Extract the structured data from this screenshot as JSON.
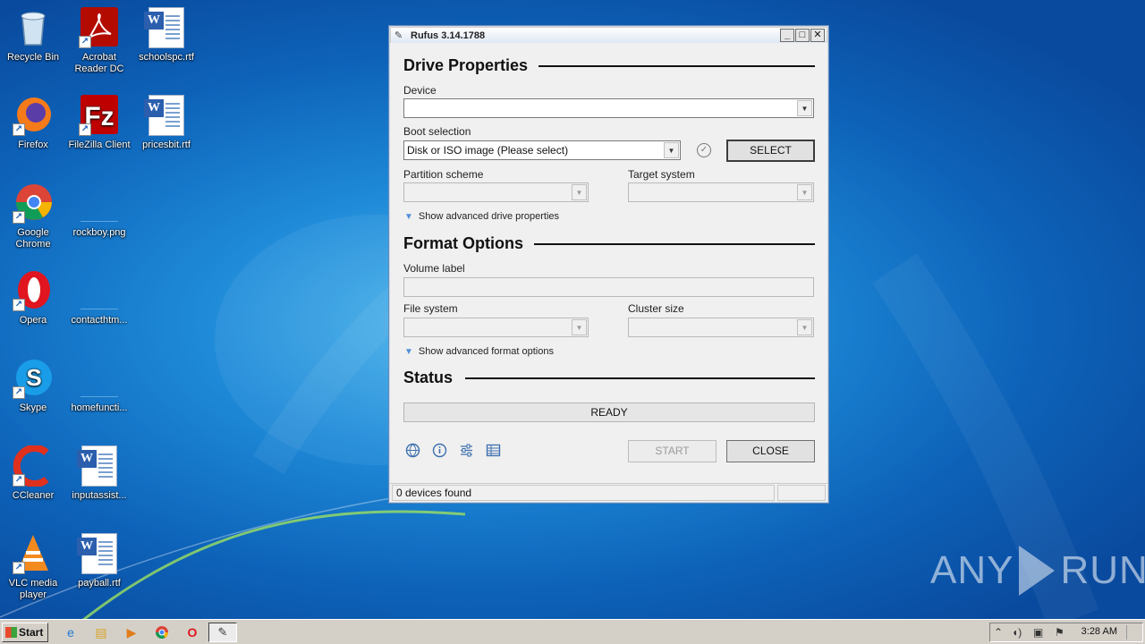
{
  "desktop": {
    "icons": [
      {
        "label": "Recycle Bin",
        "icon": "recycle-bin-icon"
      },
      {
        "label": "Acrobat Reader DC",
        "icon": "acrobat-icon"
      },
      {
        "label": "schoolspc.rtf",
        "icon": "word-doc-icon"
      },
      {
        "label": "Firefox",
        "icon": "firefox-icon"
      },
      {
        "label": "FileZilla Client",
        "icon": "filezilla-icon"
      },
      {
        "label": "pricesbit.rtf",
        "icon": "word-doc-icon"
      },
      {
        "label": "Google Chrome",
        "icon": "chrome-icon"
      },
      {
        "label": "rockboy.png",
        "icon": "blank-file-icon"
      },
      {
        "label": "Opera",
        "icon": "opera-icon"
      },
      {
        "label": "contacthtm...",
        "icon": "blank-file-icon"
      },
      {
        "label": "Skype",
        "icon": "skype-icon"
      },
      {
        "label": "homefuncti...",
        "icon": "blank-file-icon"
      },
      {
        "label": "CCleaner",
        "icon": "ccleaner-icon"
      },
      {
        "label": "inputassist...",
        "icon": "word-doc-icon"
      },
      {
        "label": "VLC media player",
        "icon": "vlc-icon"
      },
      {
        "label": "payball.rtf",
        "icon": "word-doc-icon"
      }
    ]
  },
  "window": {
    "title": "Rufus 3.14.1788",
    "controls": {
      "minimize": "_",
      "maximize": "□",
      "close": "✕"
    },
    "drive_properties": {
      "heading": "Drive Properties",
      "device_label": "Device",
      "device_value": "",
      "boot_selection_label": "Boot selection",
      "boot_selection_value": "Disk or ISO image (Please select)",
      "select_button": "SELECT",
      "partition_scheme_label": "Partition scheme",
      "partition_scheme_value": "",
      "target_system_label": "Target system",
      "target_system_value": "",
      "advanced_toggle": "Show advanced drive properties"
    },
    "format_options": {
      "heading": "Format Options",
      "volume_label_label": "Volume label",
      "volume_label_value": "",
      "file_system_label": "File system",
      "file_system_value": "",
      "cluster_size_label": "Cluster size",
      "cluster_size_value": "",
      "advanced_toggle": "Show advanced format options"
    },
    "status": {
      "heading": "Status",
      "progress_text": "READY",
      "start_button": "START",
      "close_button": "CLOSE"
    },
    "status_strip": {
      "devices": "0 devices found"
    }
  },
  "taskbar": {
    "start_label": "Start",
    "clock": "3:28 AM"
  },
  "watermark": {
    "left": "ANY",
    "right": "RUN"
  }
}
